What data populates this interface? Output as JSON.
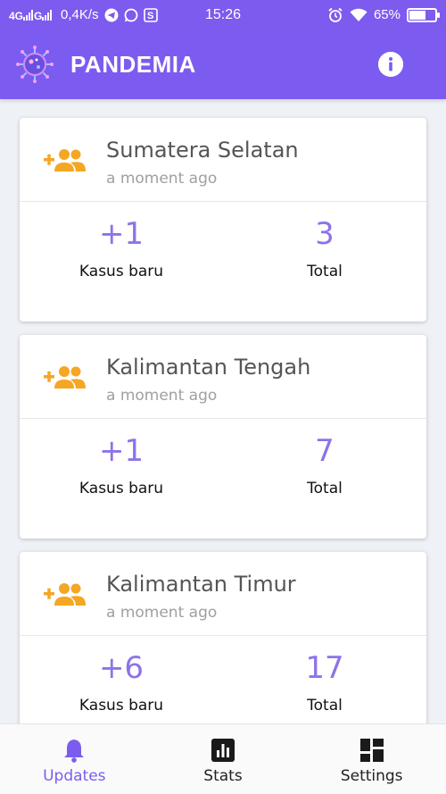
{
  "status_bar": {
    "network": "4G",
    "speed": "0,4K/s",
    "time": "15:26",
    "battery": "65%",
    "battery_level": 0.65
  },
  "app_bar": {
    "title": "PANDEMIA"
  },
  "cards": [
    {
      "region": "Sumatera Selatan",
      "time": "a moment ago",
      "new_value": "+1",
      "new_label": "Kasus baru",
      "total_value": "3",
      "total_label": "Total"
    },
    {
      "region": "Kalimantan Tengah",
      "time": "a moment ago",
      "new_value": "+1",
      "new_label": "Kasus baru",
      "total_value": "7",
      "total_label": "Total"
    },
    {
      "region": "Kalimantan Timur",
      "time": "a moment ago",
      "new_value": "+6",
      "new_label": "Kasus baru",
      "total_value": "17",
      "total_label": "Total"
    }
  ],
  "bottom_nav": {
    "items": [
      {
        "label": "Updates",
        "icon": "bell-icon",
        "active": true
      },
      {
        "label": "Stats",
        "icon": "bar-chart-icon",
        "active": false
      },
      {
        "label": "Settings",
        "icon": "dashboard-icon",
        "active": false
      }
    ]
  },
  "colors": {
    "primary": "#7c5cf0",
    "value": "#8e73e8",
    "icon_orange": "#f5a623"
  }
}
